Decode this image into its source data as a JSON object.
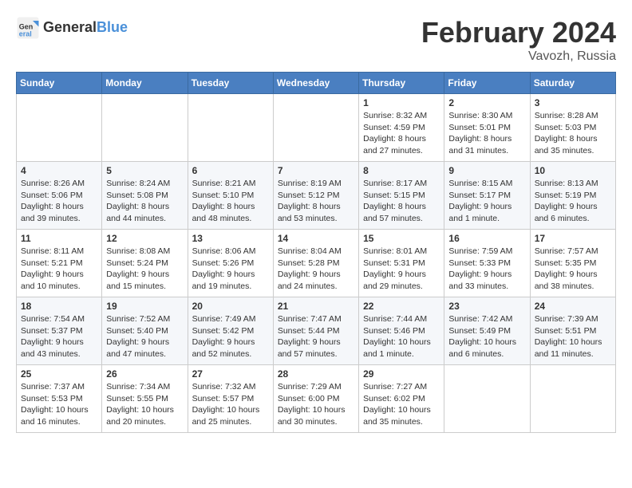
{
  "header": {
    "logo_line1": "General",
    "logo_line2": "Blue",
    "title": "February 2024",
    "subtitle": "Vavozh, Russia"
  },
  "weekdays": [
    "Sunday",
    "Monday",
    "Tuesday",
    "Wednesday",
    "Thursday",
    "Friday",
    "Saturday"
  ],
  "weeks": [
    [
      {
        "day": "",
        "info": ""
      },
      {
        "day": "",
        "info": ""
      },
      {
        "day": "",
        "info": ""
      },
      {
        "day": "",
        "info": ""
      },
      {
        "day": "1",
        "info": "Sunrise: 8:32 AM\nSunset: 4:59 PM\nDaylight: 8 hours\nand 27 minutes."
      },
      {
        "day": "2",
        "info": "Sunrise: 8:30 AM\nSunset: 5:01 PM\nDaylight: 8 hours\nand 31 minutes."
      },
      {
        "day": "3",
        "info": "Sunrise: 8:28 AM\nSunset: 5:03 PM\nDaylight: 8 hours\nand 35 minutes."
      }
    ],
    [
      {
        "day": "4",
        "info": "Sunrise: 8:26 AM\nSunset: 5:06 PM\nDaylight: 8 hours\nand 39 minutes."
      },
      {
        "day": "5",
        "info": "Sunrise: 8:24 AM\nSunset: 5:08 PM\nDaylight: 8 hours\nand 44 minutes."
      },
      {
        "day": "6",
        "info": "Sunrise: 8:21 AM\nSunset: 5:10 PM\nDaylight: 8 hours\nand 48 minutes."
      },
      {
        "day": "7",
        "info": "Sunrise: 8:19 AM\nSunset: 5:12 PM\nDaylight: 8 hours\nand 53 minutes."
      },
      {
        "day": "8",
        "info": "Sunrise: 8:17 AM\nSunset: 5:15 PM\nDaylight: 8 hours\nand 57 minutes."
      },
      {
        "day": "9",
        "info": "Sunrise: 8:15 AM\nSunset: 5:17 PM\nDaylight: 9 hours\nand 1 minute."
      },
      {
        "day": "10",
        "info": "Sunrise: 8:13 AM\nSunset: 5:19 PM\nDaylight: 9 hours\nand 6 minutes."
      }
    ],
    [
      {
        "day": "11",
        "info": "Sunrise: 8:11 AM\nSunset: 5:21 PM\nDaylight: 9 hours\nand 10 minutes."
      },
      {
        "day": "12",
        "info": "Sunrise: 8:08 AM\nSunset: 5:24 PM\nDaylight: 9 hours\nand 15 minutes."
      },
      {
        "day": "13",
        "info": "Sunrise: 8:06 AM\nSunset: 5:26 PM\nDaylight: 9 hours\nand 19 minutes."
      },
      {
        "day": "14",
        "info": "Sunrise: 8:04 AM\nSunset: 5:28 PM\nDaylight: 9 hours\nand 24 minutes."
      },
      {
        "day": "15",
        "info": "Sunrise: 8:01 AM\nSunset: 5:31 PM\nDaylight: 9 hours\nand 29 minutes."
      },
      {
        "day": "16",
        "info": "Sunrise: 7:59 AM\nSunset: 5:33 PM\nDaylight: 9 hours\nand 33 minutes."
      },
      {
        "day": "17",
        "info": "Sunrise: 7:57 AM\nSunset: 5:35 PM\nDaylight: 9 hours\nand 38 minutes."
      }
    ],
    [
      {
        "day": "18",
        "info": "Sunrise: 7:54 AM\nSunset: 5:37 PM\nDaylight: 9 hours\nand 43 minutes."
      },
      {
        "day": "19",
        "info": "Sunrise: 7:52 AM\nSunset: 5:40 PM\nDaylight: 9 hours\nand 47 minutes."
      },
      {
        "day": "20",
        "info": "Sunrise: 7:49 AM\nSunset: 5:42 PM\nDaylight: 9 hours\nand 52 minutes."
      },
      {
        "day": "21",
        "info": "Sunrise: 7:47 AM\nSunset: 5:44 PM\nDaylight: 9 hours\nand 57 minutes."
      },
      {
        "day": "22",
        "info": "Sunrise: 7:44 AM\nSunset: 5:46 PM\nDaylight: 10 hours\nand 1 minute."
      },
      {
        "day": "23",
        "info": "Sunrise: 7:42 AM\nSunset: 5:49 PM\nDaylight: 10 hours\nand 6 minutes."
      },
      {
        "day": "24",
        "info": "Sunrise: 7:39 AM\nSunset: 5:51 PM\nDaylight: 10 hours\nand 11 minutes."
      }
    ],
    [
      {
        "day": "25",
        "info": "Sunrise: 7:37 AM\nSunset: 5:53 PM\nDaylight: 10 hours\nand 16 minutes."
      },
      {
        "day": "26",
        "info": "Sunrise: 7:34 AM\nSunset: 5:55 PM\nDaylight: 10 hours\nand 20 minutes."
      },
      {
        "day": "27",
        "info": "Sunrise: 7:32 AM\nSunset: 5:57 PM\nDaylight: 10 hours\nand 25 minutes."
      },
      {
        "day": "28",
        "info": "Sunrise: 7:29 AM\nSunset: 6:00 PM\nDaylight: 10 hours\nand 30 minutes."
      },
      {
        "day": "29",
        "info": "Sunrise: 7:27 AM\nSunset: 6:02 PM\nDaylight: 10 hours\nand 35 minutes."
      },
      {
        "day": "",
        "info": ""
      },
      {
        "day": "",
        "info": ""
      }
    ]
  ]
}
